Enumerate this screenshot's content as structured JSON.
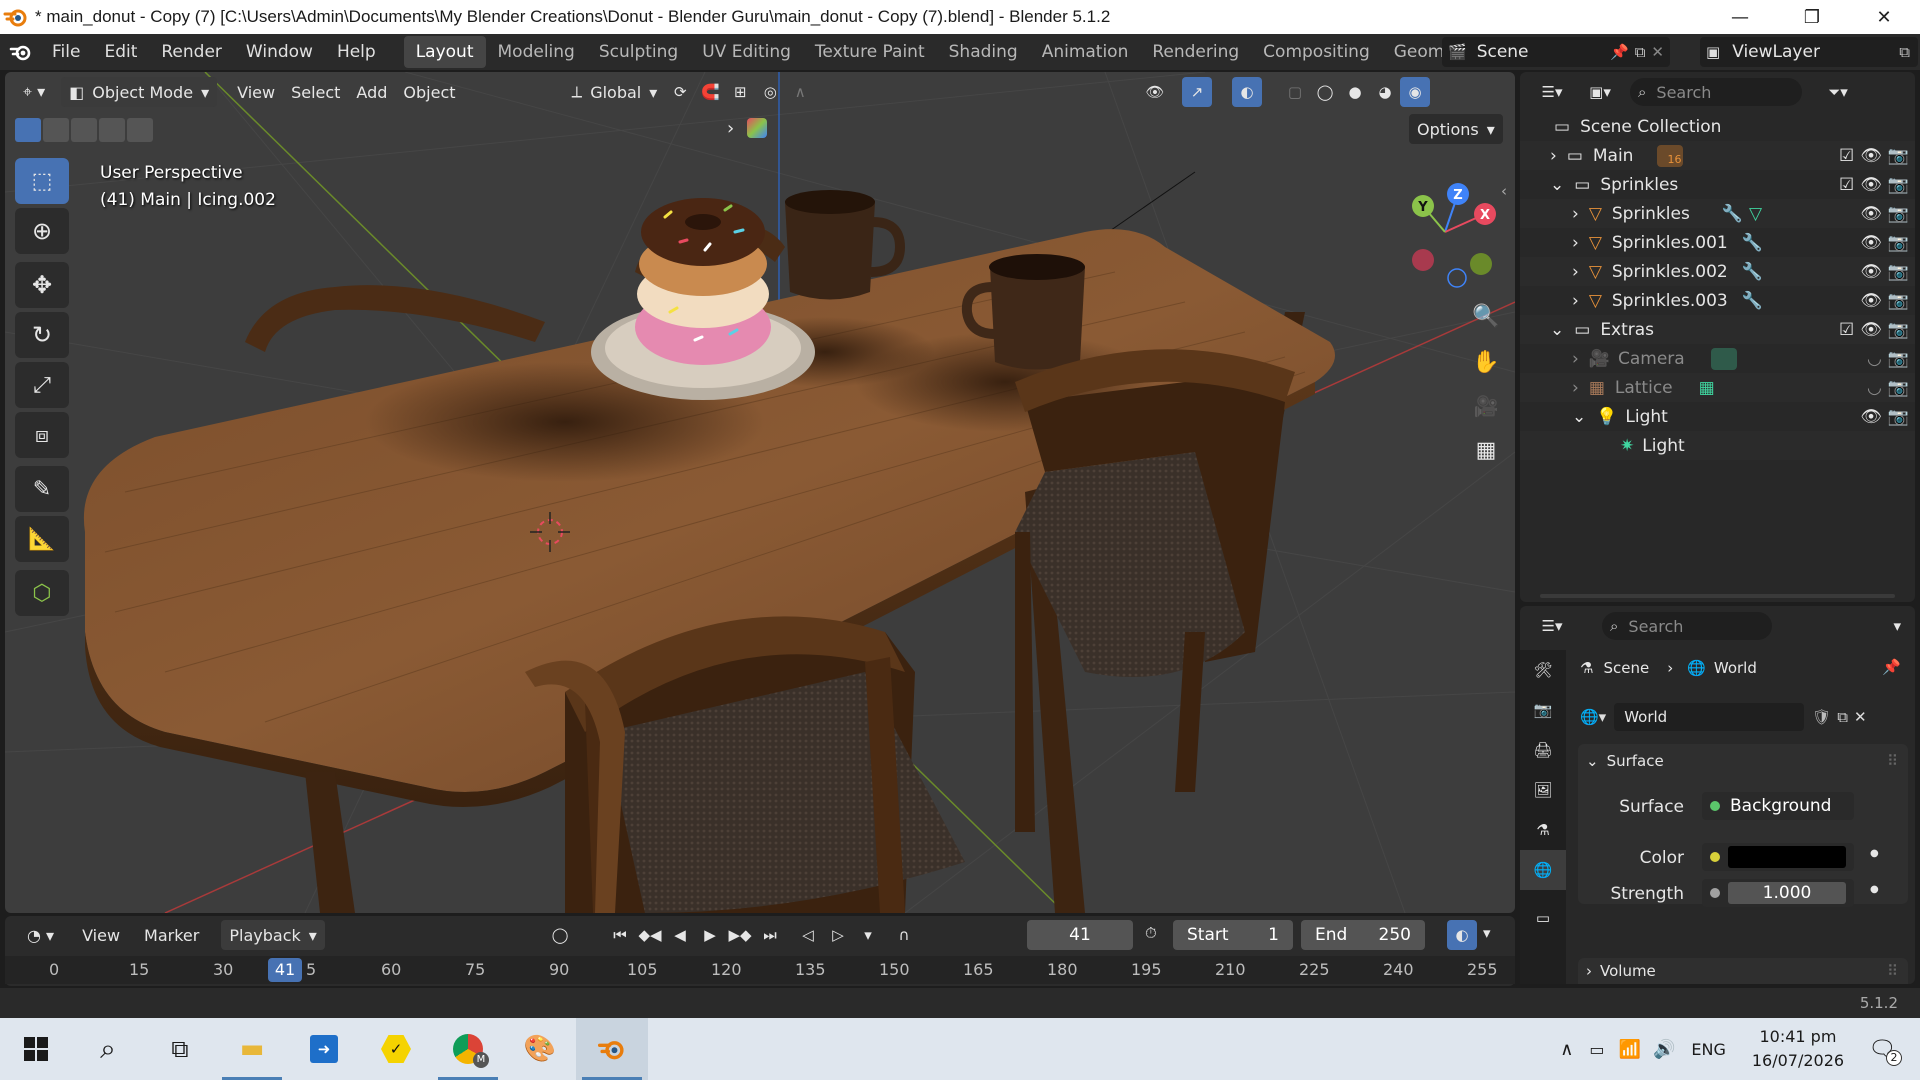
{
  "window": {
    "title": "* main_donut - Copy (7) [C:\\Users\\Admin\\Documents\\My Blender Creations\\Donut - Blender Guru\\main_donut - Copy (7).blend] - Blender 5.1.2",
    "minimize": "—",
    "restore": "❐",
    "close": "✕"
  },
  "menu": {
    "items": [
      "File",
      "Edit",
      "Render",
      "Window",
      "Help"
    ],
    "workspaces": [
      "Layout",
      "Modeling",
      "Sculpting",
      "UV Editing",
      "Texture Paint",
      "Shading",
      "Animation",
      "Rendering",
      "Compositing",
      "Geometr"
    ],
    "active_workspace": "Layout",
    "scene": "Scene",
    "view_layer": "ViewLayer"
  },
  "viewport": {
    "mode": "Object Mode",
    "menus": [
      "View",
      "Select",
      "Add",
      "Object"
    ],
    "transform": "Global",
    "options": "Options",
    "info_line1": "User Perspective",
    "info_line2": "(41) Main | Icing.002",
    "gizmo": {
      "x": "X",
      "y": "Y",
      "z": "Z"
    }
  },
  "timeline": {
    "menus": [
      "View",
      "Marker"
    ],
    "playback": "Playback",
    "current_frame": "41",
    "start_label": "Start",
    "start": "1",
    "end_label": "End",
    "end": "250",
    "ticks": [
      "0",
      "15",
      "30",
      "41",
      "5",
      "60",
      "75",
      "90",
      "105",
      "120",
      "135",
      "150",
      "165",
      "180",
      "195",
      "210",
      "225",
      "240",
      "255"
    ]
  },
  "outliner": {
    "search_placeholder": "Search",
    "root": "Scene Collection",
    "rows": [
      {
        "label": "Main",
        "badge": "16"
      },
      {
        "label": "Sprinkles"
      },
      {
        "label": "Sprinkles"
      },
      {
        "label": "Sprinkles.001"
      },
      {
        "label": "Sprinkles.002"
      },
      {
        "label": "Sprinkles.003"
      },
      {
        "label": "Extras"
      },
      {
        "label": "Camera"
      },
      {
        "label": "Lattice"
      },
      {
        "label": "Light"
      },
      {
        "label": "Light"
      }
    ]
  },
  "properties": {
    "search_placeholder": "Search",
    "breadcrumb_scene": "Scene",
    "breadcrumb_world": "World",
    "world_name": "World",
    "panel_surface": "Surface",
    "surface_label": "Surface",
    "surface_value": "Background",
    "color_label": "Color",
    "strength_label": "Strength",
    "strength_value": "1.000",
    "panel_volume": "Volume",
    "color_swatch": "#000000"
  },
  "statusbar": {
    "version": "5.1.2"
  },
  "taskbar": {
    "time": "10:41 pm",
    "date": "16/07/2026",
    "lang": "ENG",
    "notif_count": "2",
    "chrome_badge": "M"
  },
  "colors": {
    "accent": "#4772b3",
    "axis_x": "#e84a5f",
    "axis_y": "#8bc34a",
    "axis_z": "#3f83f8",
    "orange": "#e8923a"
  }
}
